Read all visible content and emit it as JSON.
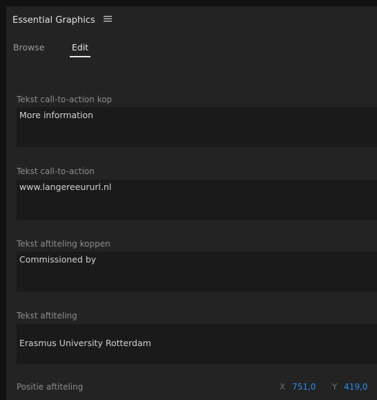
{
  "panel": {
    "title": "Essential Graphics",
    "menu_icon": "hamburger-menu-icon"
  },
  "tabs": [
    {
      "label": "Browse",
      "active": false
    },
    {
      "label": "Edit",
      "active": true
    }
  ],
  "fields": [
    {
      "label": "Tekst call-to-action kop",
      "value": "More information"
    },
    {
      "label": "Tekst call-to-action",
      "value": "www.langereeururl.nl"
    },
    {
      "label": "Tekst aftiteling koppen",
      "value": "Commissioned by"
    },
    {
      "label": "Tekst aftiteling",
      "value": "Erasmus University Rotterdam"
    }
  ],
  "position": {
    "label": "Positie aftiteling",
    "x_label": "X",
    "x_value": "751,0",
    "y_label": "Y",
    "y_value": "419,0"
  },
  "colors": {
    "background": "#232323",
    "field_background": "#1a1a1a",
    "accent_value": "#2d8ceb"
  }
}
